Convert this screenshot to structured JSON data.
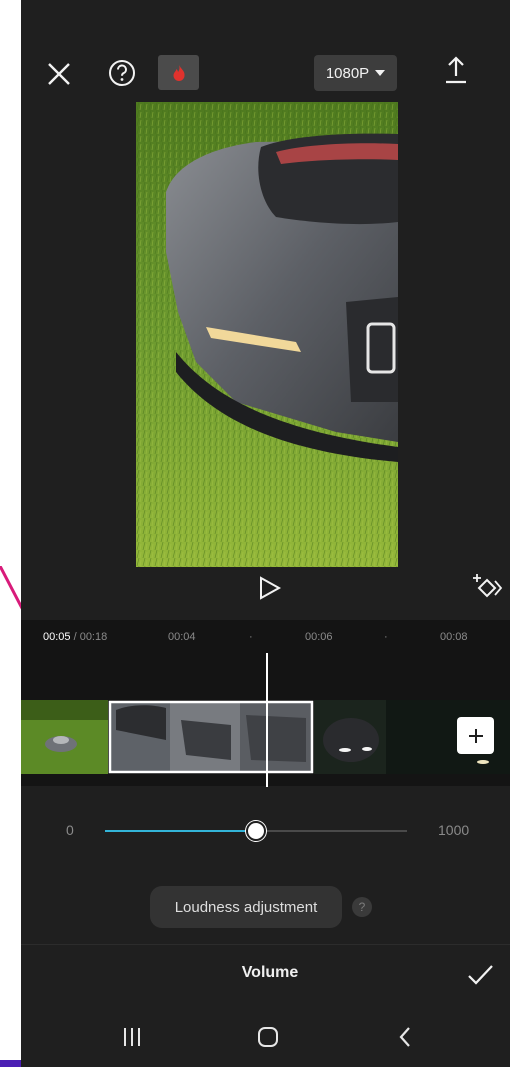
{
  "toolbar": {
    "close_icon": "close-icon",
    "help_icon": "help-circle-icon",
    "flame_icon": "flame-icon",
    "resolution_label": "1080P",
    "export_icon": "upload-icon"
  },
  "preview": {
    "play_icon": "play-icon",
    "keyframe_icon": "keyframe-icon"
  },
  "timeline": {
    "current_time": "00:05",
    "total_time": " / 00:18",
    "ticks": [
      "00:04",
      "·",
      "00:06",
      "·",
      "00:08"
    ],
    "add_clip_icon": "plus-icon"
  },
  "volume": {
    "min_label": "0",
    "max_label": "1000",
    "value_fraction": 0.5,
    "loudness_label": "Loudness adjustment",
    "loudness_help": "?",
    "panel_title": "Volume",
    "confirm_icon": "checkmark-icon"
  },
  "navbar": {
    "recents_icon": "recents-icon",
    "home_icon": "home-icon",
    "back_icon": "back-icon"
  },
  "colors": {
    "accent": "#33b4d8",
    "background": "#1f1f1f",
    "flame": "#e0322d"
  }
}
